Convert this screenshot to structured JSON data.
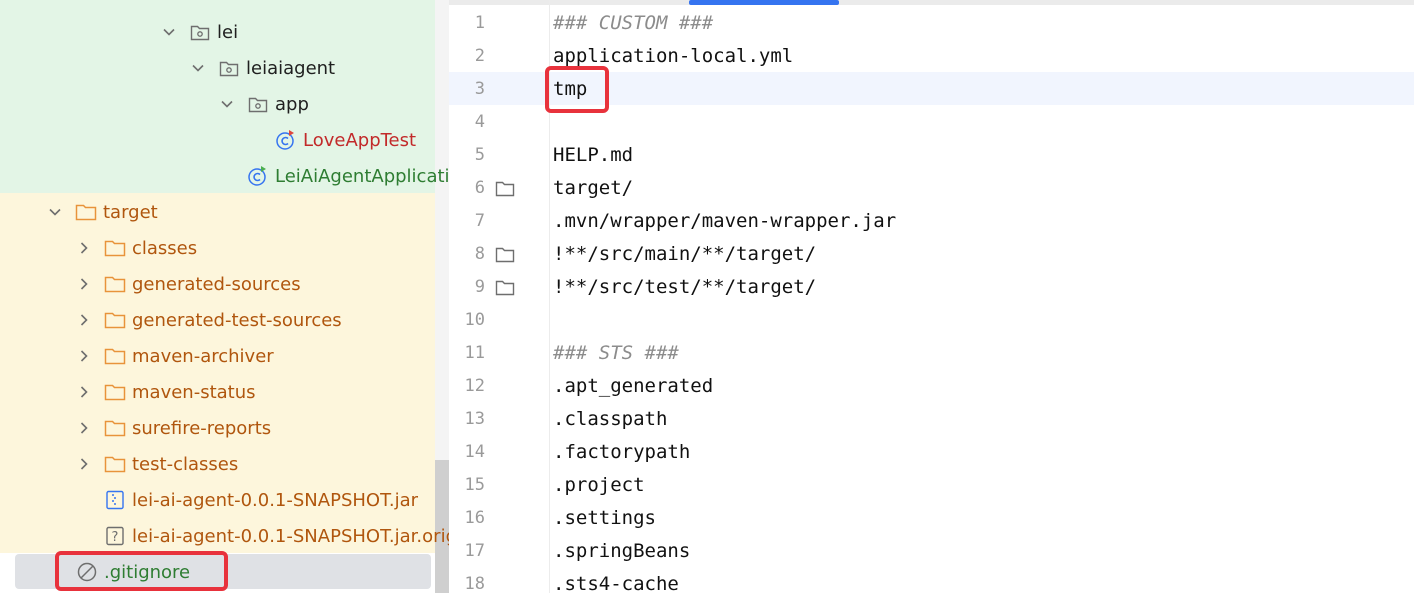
{
  "project_tree": {
    "items": [
      {
        "label": "lei",
        "type": "package",
        "expanded": true
      },
      {
        "label": "leiaiagent",
        "type": "package",
        "expanded": true
      },
      {
        "label": "app",
        "type": "package",
        "expanded": true
      },
      {
        "label": "LoveAppTest",
        "type": "test-class",
        "color": "#c22a2a"
      },
      {
        "label": "LeiAiAgentApplicati",
        "type": "test-class",
        "color": "#2e7d32"
      },
      {
        "label": "target",
        "type": "folder",
        "expanded": true
      },
      {
        "label": "classes",
        "type": "folder",
        "expanded": false
      },
      {
        "label": "generated-sources",
        "type": "folder",
        "expanded": false
      },
      {
        "label": "generated-test-sources",
        "type": "folder",
        "expanded": false
      },
      {
        "label": "maven-archiver",
        "type": "folder",
        "expanded": false
      },
      {
        "label": "maven-status",
        "type": "folder",
        "expanded": false
      },
      {
        "label": "surefire-reports",
        "type": "folder",
        "expanded": false
      },
      {
        "label": "test-classes",
        "type": "folder",
        "expanded": false
      },
      {
        "label": "lei-ai-agent-0.0.1-SNAPSHOT.jar",
        "type": "jar"
      },
      {
        "label": "lei-ai-agent-0.0.1-SNAPSHOT.jar.origi",
        "type": "unknown-file"
      },
      {
        "label": ".gitignore",
        "type": "gitignore",
        "selected": true
      }
    ]
  },
  "editor": {
    "lines": [
      {
        "n": "1",
        "text": "### CUSTOM ###",
        "comment": true
      },
      {
        "n": "2",
        "text": "application-local.yml"
      },
      {
        "n": "3",
        "text": "tmp",
        "current": true
      },
      {
        "n": "4",
        "text": ""
      },
      {
        "n": "5",
        "text": "HELP.md"
      },
      {
        "n": "6",
        "text": "target/",
        "folder_marker": true
      },
      {
        "n": "7",
        "text": ".mvn/wrapper/maven-wrapper.jar"
      },
      {
        "n": "8",
        "text": "!**/src/main/**/target/",
        "folder_marker": true
      },
      {
        "n": "9",
        "text": "!**/src/test/**/target/",
        "folder_marker": true
      },
      {
        "n": "10",
        "text": ""
      },
      {
        "n": "11",
        "text": "### STS ###",
        "comment": true
      },
      {
        "n": "12",
        "text": ".apt_generated"
      },
      {
        "n": "13",
        "text": ".classpath"
      },
      {
        "n": "14",
        "text": ".factorypath"
      },
      {
        "n": "15",
        "text": ".project"
      },
      {
        "n": "16",
        "text": ".settings"
      },
      {
        "n": "17",
        "text": ".springBeans"
      },
      {
        "n": "18",
        "text": ".sts4-cache"
      }
    ]
  },
  "colors": {
    "accent": "#3574f0",
    "highlight_box": "#e8323c",
    "tree_green_band": "#e3f5e6",
    "tree_yellow_band": "#fdf6dc",
    "folder_orange": "#e8933a"
  }
}
